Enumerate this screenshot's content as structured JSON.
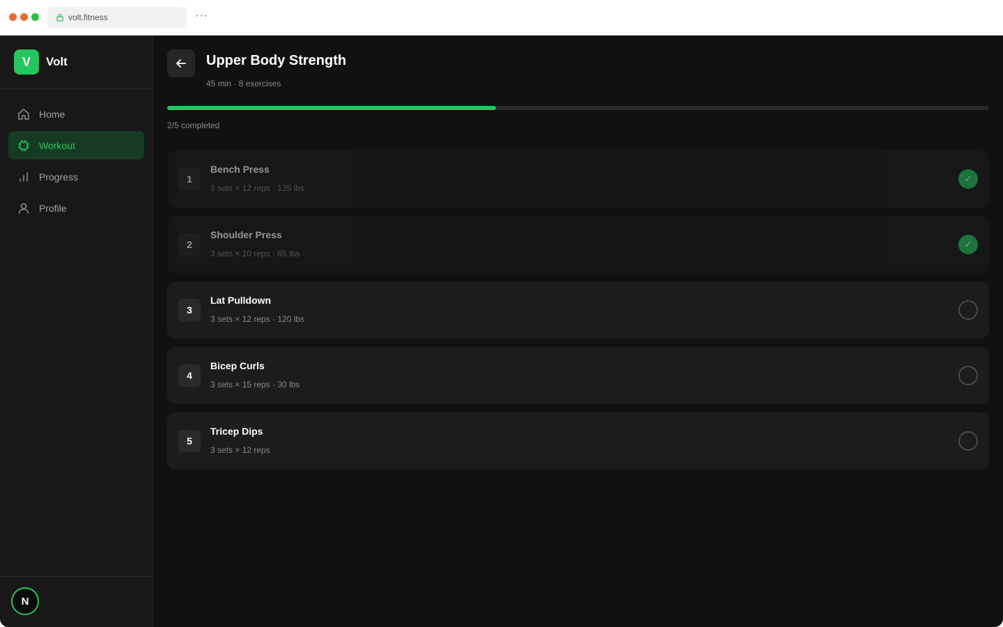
{
  "browser": {
    "url": "volt.fitness",
    "more_label": "···"
  },
  "sidebar": {
    "brand_letter": "V",
    "brand_name": "Volt",
    "items": [
      {
        "label": "Home",
        "icon": "home-icon",
        "active": false
      },
      {
        "label": "Workout",
        "icon": "dumbbell-icon",
        "active": true
      },
      {
        "label": "Progress",
        "icon": "bar-chart-icon",
        "active": false
      },
      {
        "label": "Profile",
        "icon": "user-icon",
        "active": false
      }
    ],
    "user_initial": "N"
  },
  "workout": {
    "title": "Upper Body Strength",
    "subtitle": "45 min · 8 exercises",
    "progress_fraction": 0.4,
    "progress_text": "2/5 completed",
    "exercises": [
      {
        "number": "1",
        "name": "Bench Press",
        "meta": "3 sets × 12 reps · 135 lbs",
        "done": true
      },
      {
        "number": "2",
        "name": "Shoulder Press",
        "meta": "3 sets × 10 reps · 85 lbs",
        "done": true
      },
      {
        "number": "3",
        "name": "Lat Pulldown",
        "meta": "3 sets × 12 reps · 120 lbs",
        "done": false
      },
      {
        "number": "4",
        "name": "Bicep Curls",
        "meta": "3 sets × 15 reps · 30 lbs",
        "done": false
      },
      {
        "number": "5",
        "name": "Tricep Dips",
        "meta": "3 sets × 12 reps",
        "done": false
      }
    ],
    "check_mark": "✓"
  },
  "colors": {
    "accent": "#22c55e",
    "background": "#111111",
    "sidebar": "#181818"
  }
}
